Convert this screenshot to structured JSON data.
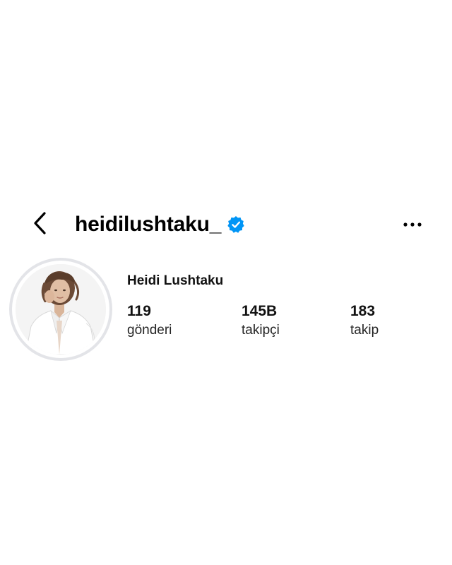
{
  "header": {
    "back_icon": "chevron-left-icon",
    "username": "heidilushtaku_",
    "verified_icon": "verified-badge-icon",
    "more_icon": "more-horizontal-icon"
  },
  "profile": {
    "display_name": "Heidi Lushtaku",
    "avatar_icon": "profile-photo",
    "stats": {
      "posts": {
        "value": "119",
        "label": "gönderi"
      },
      "followers": {
        "value": "145B",
        "label": "takipçi"
      },
      "following": {
        "value": "183",
        "label": "takip"
      }
    }
  },
  "colors": {
    "verified": "#0095f6",
    "text": "#000000",
    "avatar_ring": "#e3e4e8"
  }
}
